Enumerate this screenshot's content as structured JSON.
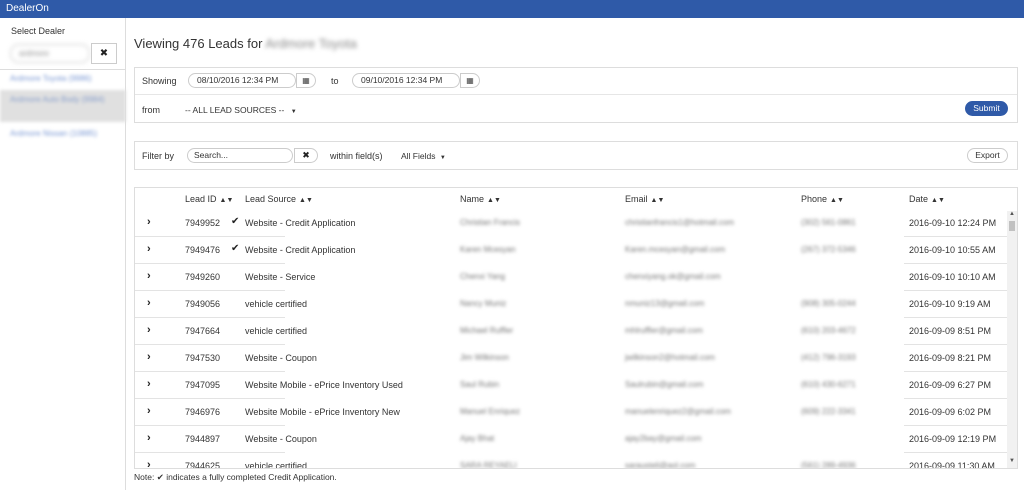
{
  "app": {
    "title": "DealerOn"
  },
  "sidebar": {
    "label": "Select Dealer",
    "search_value": "ardmore",
    "dealers": [
      "Ardmore Toyota (9986)",
      "Ardmore Auto Body (9984)",
      "Ardmore Nissan (10885)"
    ]
  },
  "main": {
    "title_prefix": "Viewing 476 Leads for",
    "dealer_name": "Ardmore Toyota"
  },
  "filters": {
    "showing_label": "Showing",
    "from_date": "08/10/2016 12:34 PM",
    "to_label": "to",
    "to_date": "09/10/2016 12:34 PM",
    "from_label": "from",
    "lead_source": "-- ALL LEAD SOURCES --",
    "submit_label": "Submit",
    "filter_label": "Filter by",
    "search_placeholder": "Search...",
    "within_label": "within field(s)",
    "fields_value": "All Fields",
    "export_label": "Export"
  },
  "table": {
    "headers": {
      "lead_id": "Lead ID",
      "lead_source": "Lead Source",
      "name": "Name",
      "email": "Email",
      "phone": "Phone",
      "date": "Date"
    },
    "rows": [
      {
        "id": "7949952",
        "source": "Website - Credit Application",
        "check": true,
        "name": "Christian Francis",
        "email": "christianfrancis1@hotmail.com",
        "phone": "(302) 561-0861",
        "date": "2016-09-10 12:24 PM"
      },
      {
        "id": "7949476",
        "source": "Website - Credit Application",
        "check": true,
        "name": "Karen Mcesyan",
        "email": "Karen.mcesyan@gmail.com",
        "phone": "(267) 372-5346",
        "date": "2016-09-10 10:55 AM"
      },
      {
        "id": "7949260",
        "source": "Website - Service",
        "check": false,
        "name": "Chenxi Yang",
        "email": "chenxiyang.ok@gmail.com",
        "phone": "",
        "date": "2016-09-10 10:10 AM"
      },
      {
        "id": "7949056",
        "source": "vehicle certified",
        "check": false,
        "name": "Nancy Muniz",
        "email": "nmuniz13@gmail.com",
        "phone": "(908) 305-0244",
        "date": "2016-09-10 9:19 AM"
      },
      {
        "id": "7947664",
        "source": "vehicle certified",
        "check": false,
        "name": "Michael Ruffler",
        "email": "mhlruffler@gmail.com",
        "phone": "(610) 203-4672",
        "date": "2016-09-09 8:51 PM"
      },
      {
        "id": "7947530",
        "source": "Website - Coupon",
        "check": false,
        "name": "Jim Wilkinson",
        "email": "jwilkinson2@hotmail.com",
        "phone": "(412) 796-3193",
        "date": "2016-09-09 8:21 PM"
      },
      {
        "id": "7947095",
        "source": "Website Mobile - ePrice Inventory Used",
        "check": false,
        "name": "Saul Rubin",
        "email": "Saulrubin@gmail.com",
        "phone": "(610) 430-6271",
        "date": "2016-09-09 6:27 PM"
      },
      {
        "id": "7946976",
        "source": "Website Mobile - ePrice Inventory New",
        "check": false,
        "name": "Manuel Enriquez",
        "email": "manuelenriquez2@gmail.com",
        "phone": "(609) 222-3341",
        "date": "2016-09-09 6:02 PM"
      },
      {
        "id": "7944897",
        "source": "Website - Coupon",
        "check": false,
        "name": "Ajay Bhat",
        "email": "ajay2bay@gmail.com",
        "phone": "",
        "date": "2016-09-09 12:19 PM"
      },
      {
        "id": "7944625",
        "source": "vehicle certified",
        "check": false,
        "name": "SARA REYAELI",
        "email": "sarausteli@aol.com",
        "phone": "(561) 289-4936",
        "date": "2016-09-09 11:30 AM"
      }
    ]
  },
  "footer": {
    "note_prefix": "Note:",
    "note_text": "indicates a fully completed Credit Application."
  },
  "icons": {
    "check": "check-icon",
    "calendar": "calendar-icon",
    "chevron": "chevron-right-icon",
    "clear": "close-icon",
    "sort": "sort-icon"
  },
  "colors": {
    "brand": "#2f5aa8"
  }
}
